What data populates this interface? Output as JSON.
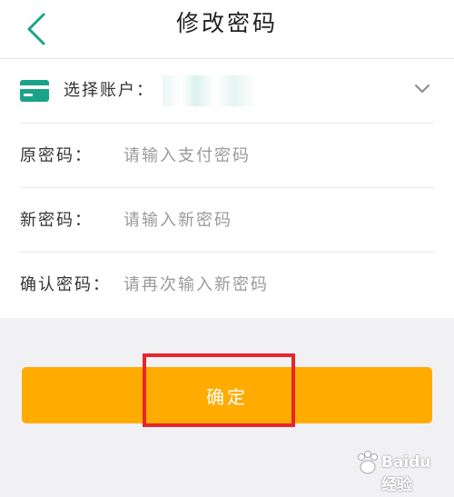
{
  "header": {
    "title": "修改密码"
  },
  "account": {
    "label": "选择账户："
  },
  "fields": [
    {
      "label": "原密码：",
      "placeholder": "请输入支付密码"
    },
    {
      "label": "新密码：",
      "placeholder": "请输入新密码"
    },
    {
      "label": "确认密码：",
      "placeholder": "请再次输入新密码"
    }
  ],
  "confirm": {
    "label": "确定"
  },
  "watermark": {
    "text": "Baidu 经验"
  },
  "colors": {
    "accent": "#1aa38a",
    "button": "#ffab00",
    "highlight": "#e8242c"
  },
  "icons": {
    "back": "back-arrow-icon",
    "card": "credit-card-icon",
    "expand": "chevron-down-icon"
  }
}
